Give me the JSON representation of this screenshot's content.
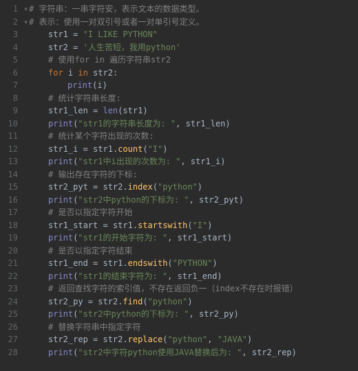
{
  "lines": [
    {
      "n": "1",
      "indent": 0,
      "fold": true,
      "tokens": [
        {
          "c": "comment",
          "t": "# 字符串：一串字符安，表示文本的数据类型。"
        }
      ]
    },
    {
      "n": "2",
      "indent": 0,
      "fold": true,
      "tokens": [
        {
          "c": "comment",
          "t": "# 表示：使用一对双引号或者一对单引号定义。"
        }
      ]
    },
    {
      "n": "3",
      "indent": 1,
      "fold": false,
      "tokens": [
        {
          "c": "ident",
          "t": "str1"
        },
        {
          "c": "eq",
          "t": " = "
        },
        {
          "c": "string",
          "t": "\"I LIKE PYTHON\""
        }
      ]
    },
    {
      "n": "4",
      "indent": 1,
      "fold": false,
      "tokens": [
        {
          "c": "ident",
          "t": "str2"
        },
        {
          "c": "eq",
          "t": " = "
        },
        {
          "c": "string",
          "t": "'人生苦短，我用python'"
        }
      ]
    },
    {
      "n": "5",
      "indent": 1,
      "fold": false,
      "tokens": [
        {
          "c": "comment",
          "t": "# 使用for in 遍历字符串str2"
        }
      ]
    },
    {
      "n": "6",
      "indent": 1,
      "fold": false,
      "tokens": [
        {
          "c": "keyword",
          "t": "for "
        },
        {
          "c": "ident",
          "t": "i"
        },
        {
          "c": "keyword",
          "t": " in "
        },
        {
          "c": "ident",
          "t": "str2"
        },
        {
          "c": "paren",
          "t": ":"
        }
      ]
    },
    {
      "n": "7",
      "indent": 2,
      "fold": false,
      "tokens": [
        {
          "c": "builtin",
          "t": "print"
        },
        {
          "c": "paren",
          "t": "("
        },
        {
          "c": "ident",
          "t": "i"
        },
        {
          "c": "paren",
          "t": ")"
        }
      ]
    },
    {
      "n": "8",
      "indent": 1,
      "fold": false,
      "tokens": [
        {
          "c": "comment",
          "t": "# 统计字符串长度:"
        }
      ]
    },
    {
      "n": "9",
      "indent": 1,
      "fold": false,
      "tokens": [
        {
          "c": "ident",
          "t": "str1_len"
        },
        {
          "c": "eq",
          "t": " = "
        },
        {
          "c": "builtin",
          "t": "len"
        },
        {
          "c": "paren",
          "t": "("
        },
        {
          "c": "ident",
          "t": "str1"
        },
        {
          "c": "paren",
          "t": ")"
        }
      ]
    },
    {
      "n": "10",
      "indent": 1,
      "fold": false,
      "tokens": [
        {
          "c": "builtin",
          "t": "print"
        },
        {
          "c": "paren",
          "t": "("
        },
        {
          "c": "string",
          "t": "\"str1的字符串长度为: \""
        },
        {
          "c": "paren",
          "t": ", "
        },
        {
          "c": "ident",
          "t": "str1_len"
        },
        {
          "c": "paren",
          "t": ")"
        }
      ]
    },
    {
      "n": "11",
      "indent": 1,
      "fold": false,
      "tokens": [
        {
          "c": "comment",
          "t": "# 统计某个字符出现的次数:"
        }
      ]
    },
    {
      "n": "12",
      "indent": 1,
      "fold": false,
      "tokens": [
        {
          "c": "ident",
          "t": "str1_i"
        },
        {
          "c": "eq",
          "t": " = "
        },
        {
          "c": "ident",
          "t": "str1"
        },
        {
          "c": "paren",
          "t": "."
        },
        {
          "c": "func",
          "t": "count"
        },
        {
          "c": "paren",
          "t": "("
        },
        {
          "c": "string",
          "t": "\"I\""
        },
        {
          "c": "paren",
          "t": ")"
        }
      ]
    },
    {
      "n": "13",
      "indent": 1,
      "fold": false,
      "tokens": [
        {
          "c": "builtin",
          "t": "print"
        },
        {
          "c": "paren",
          "t": "("
        },
        {
          "c": "string",
          "t": "\"str1中i出现的次数为: \""
        },
        {
          "c": "paren",
          "t": ", "
        },
        {
          "c": "ident",
          "t": "str1_i"
        },
        {
          "c": "paren",
          "t": ")"
        }
      ]
    },
    {
      "n": "14",
      "indent": 1,
      "fold": false,
      "tokens": [
        {
          "c": "comment",
          "t": "# 输出存在字符的下标:"
        }
      ]
    },
    {
      "n": "15",
      "indent": 1,
      "fold": false,
      "tokens": [
        {
          "c": "ident",
          "t": "str2_pyt"
        },
        {
          "c": "eq",
          "t": " = "
        },
        {
          "c": "ident",
          "t": "str2"
        },
        {
          "c": "paren",
          "t": "."
        },
        {
          "c": "func",
          "t": "index"
        },
        {
          "c": "paren",
          "t": "("
        },
        {
          "c": "string",
          "t": "\"python\""
        },
        {
          "c": "paren",
          "t": ")"
        }
      ]
    },
    {
      "n": "16",
      "indent": 1,
      "fold": false,
      "tokens": [
        {
          "c": "builtin",
          "t": "print"
        },
        {
          "c": "paren",
          "t": "("
        },
        {
          "c": "string",
          "t": "\"str2中python的下标为: \""
        },
        {
          "c": "paren",
          "t": ", "
        },
        {
          "c": "ident",
          "t": "str2_pyt"
        },
        {
          "c": "paren",
          "t": ")"
        }
      ]
    },
    {
      "n": "17",
      "indent": 1,
      "fold": false,
      "tokens": [
        {
          "c": "comment",
          "t": "# 是否以指定字符开始"
        }
      ]
    },
    {
      "n": "18",
      "indent": 1,
      "fold": false,
      "tokens": [
        {
          "c": "ident",
          "t": "str1_start"
        },
        {
          "c": "eq",
          "t": " = "
        },
        {
          "c": "ident",
          "t": "str1"
        },
        {
          "c": "paren",
          "t": "."
        },
        {
          "c": "func",
          "t": "startswith"
        },
        {
          "c": "paren",
          "t": "("
        },
        {
          "c": "string",
          "t": "\"I\""
        },
        {
          "c": "paren",
          "t": ")"
        }
      ]
    },
    {
      "n": "19",
      "indent": 1,
      "fold": false,
      "tokens": [
        {
          "c": "builtin",
          "t": "print"
        },
        {
          "c": "paren",
          "t": "("
        },
        {
          "c": "string",
          "t": "\"str1的开始字符为: \""
        },
        {
          "c": "paren",
          "t": ", "
        },
        {
          "c": "ident",
          "t": "str1_start"
        },
        {
          "c": "paren",
          "t": ")"
        }
      ]
    },
    {
      "n": "20",
      "indent": 1,
      "fold": false,
      "tokens": [
        {
          "c": "comment",
          "t": "# 是否以指定字符结束"
        }
      ]
    },
    {
      "n": "21",
      "indent": 1,
      "fold": false,
      "tokens": [
        {
          "c": "ident",
          "t": "str1_end"
        },
        {
          "c": "eq",
          "t": " = "
        },
        {
          "c": "ident",
          "t": "str1"
        },
        {
          "c": "paren",
          "t": "."
        },
        {
          "c": "func",
          "t": "endswith"
        },
        {
          "c": "paren",
          "t": "("
        },
        {
          "c": "string",
          "t": "\"PYTHON\""
        },
        {
          "c": "paren",
          "t": ")"
        }
      ]
    },
    {
      "n": "22",
      "indent": 1,
      "fold": false,
      "tokens": [
        {
          "c": "builtin",
          "t": "print"
        },
        {
          "c": "paren",
          "t": "("
        },
        {
          "c": "string",
          "t": "\"str1的结束字符为: \""
        },
        {
          "c": "paren",
          "t": ", "
        },
        {
          "c": "ident",
          "t": "str1_end"
        },
        {
          "c": "paren",
          "t": ")"
        }
      ]
    },
    {
      "n": "23",
      "indent": 1,
      "fold": false,
      "tokens": [
        {
          "c": "comment",
          "t": "# 返回查找字符的索引值，不存在返回负一（index不存在时报错）"
        }
      ]
    },
    {
      "n": "24",
      "indent": 1,
      "fold": false,
      "tokens": [
        {
          "c": "ident",
          "t": "str2_py"
        },
        {
          "c": "eq",
          "t": " = "
        },
        {
          "c": "ident",
          "t": "str2"
        },
        {
          "c": "paren",
          "t": "."
        },
        {
          "c": "func",
          "t": "find"
        },
        {
          "c": "paren",
          "t": "("
        },
        {
          "c": "string",
          "t": "\"python\""
        },
        {
          "c": "paren",
          "t": ")"
        }
      ]
    },
    {
      "n": "25",
      "indent": 1,
      "fold": false,
      "tokens": [
        {
          "c": "builtin",
          "t": "print"
        },
        {
          "c": "paren",
          "t": "("
        },
        {
          "c": "string",
          "t": "\"str2中python的下标为: \""
        },
        {
          "c": "paren",
          "t": ", "
        },
        {
          "c": "ident",
          "t": "str2_py"
        },
        {
          "c": "paren",
          "t": ")"
        }
      ]
    },
    {
      "n": "26",
      "indent": 1,
      "fold": false,
      "tokens": [
        {
          "c": "comment",
          "t": "# 替换字符串中指定字符"
        }
      ]
    },
    {
      "n": "27",
      "indent": 1,
      "fold": false,
      "tokens": [
        {
          "c": "ident",
          "t": "str2_rep"
        },
        {
          "c": "eq",
          "t": " = "
        },
        {
          "c": "ident",
          "t": "str2"
        },
        {
          "c": "paren",
          "t": "."
        },
        {
          "c": "func",
          "t": "replace"
        },
        {
          "c": "paren",
          "t": "("
        },
        {
          "c": "string",
          "t": "\"python\""
        },
        {
          "c": "paren",
          "t": ", "
        },
        {
          "c": "string",
          "t": "\"JAVA\""
        },
        {
          "c": "paren",
          "t": ")"
        }
      ]
    },
    {
      "n": "28",
      "indent": 1,
      "fold": false,
      "tokens": [
        {
          "c": "builtin",
          "t": "print"
        },
        {
          "c": "paren",
          "t": "("
        },
        {
          "c": "string",
          "t": "\"str2中字符python使用JAVA替换后为: \""
        },
        {
          "c": "paren",
          "t": ", "
        },
        {
          "c": "ident",
          "t": "str2_rep"
        },
        {
          "c": "paren",
          "t": ")"
        }
      ]
    }
  ]
}
